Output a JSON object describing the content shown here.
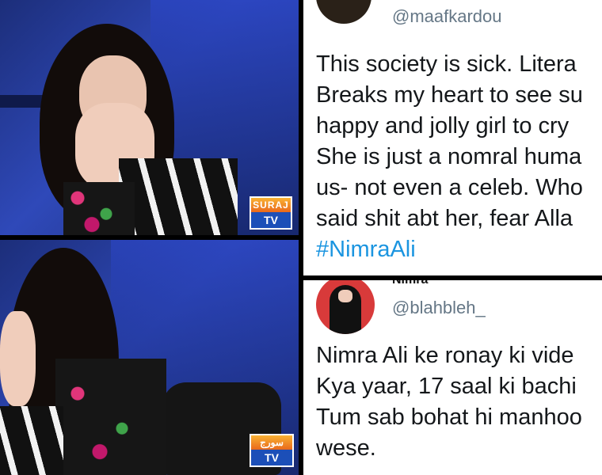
{
  "screenshots": [
    {
      "channel_logo_line1": "SURAJ",
      "channel_logo_line2": "TV"
    },
    {
      "channel_logo_line1": "سورج",
      "channel_logo_line2": "TV"
    }
  ],
  "tweets": [
    {
      "display_name": "",
      "handle": "@maafkardou",
      "lines": [
        "This society is sick. Litera",
        "Breaks my heart to see su",
        "happy and jolly girl to cry",
        "She is just a nomral huma",
        "us- not even a celeb. Who",
        "said shit abt her, fear Alla"
      ],
      "hashtag": "#NimraAli",
      "avatar_color": "#2a2118"
    },
    {
      "display_name": "Nimra",
      "handle": "@blahbleh_",
      "lines": [
        "Nimra Ali ke ronay ki vide",
        "Kya yaar, 17 saal ki bachi",
        "Tum sab bohat hi manhoo",
        "wese."
      ],
      "avatar_color": "#d83a3a"
    }
  ]
}
